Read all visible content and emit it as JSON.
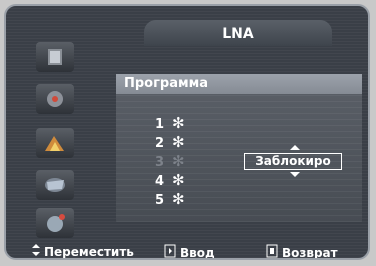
{
  "header": {
    "title": "LNA"
  },
  "sidebar": {
    "items": [
      {
        "icon": "picture-icon"
      },
      {
        "icon": "sound-icon"
      },
      {
        "icon": "channel-icon"
      },
      {
        "icon": "setup-icon"
      },
      {
        "icon": "input-icon"
      }
    ]
  },
  "panel": {
    "title": "Программа",
    "programs": [
      {
        "num": "1",
        "mark": "✻",
        "dim": false
      },
      {
        "num": "2",
        "mark": "✻",
        "dim": false
      },
      {
        "num": "3",
        "mark": "✻",
        "dim": true
      },
      {
        "num": "4",
        "mark": "✻",
        "dim": false
      },
      {
        "num": "5",
        "mark": "✻",
        "dim": false
      }
    ],
    "selector_value": "Заблокиро"
  },
  "footer": {
    "move": "Переместить",
    "enter": "Ввод",
    "back": "Возврат"
  },
  "colors": {
    "background": "#3a3f47",
    "panel": "#5b6068",
    "panel_title": "#9ca2ab",
    "text": "#ffffff",
    "dim_text": "#7d828a"
  }
}
